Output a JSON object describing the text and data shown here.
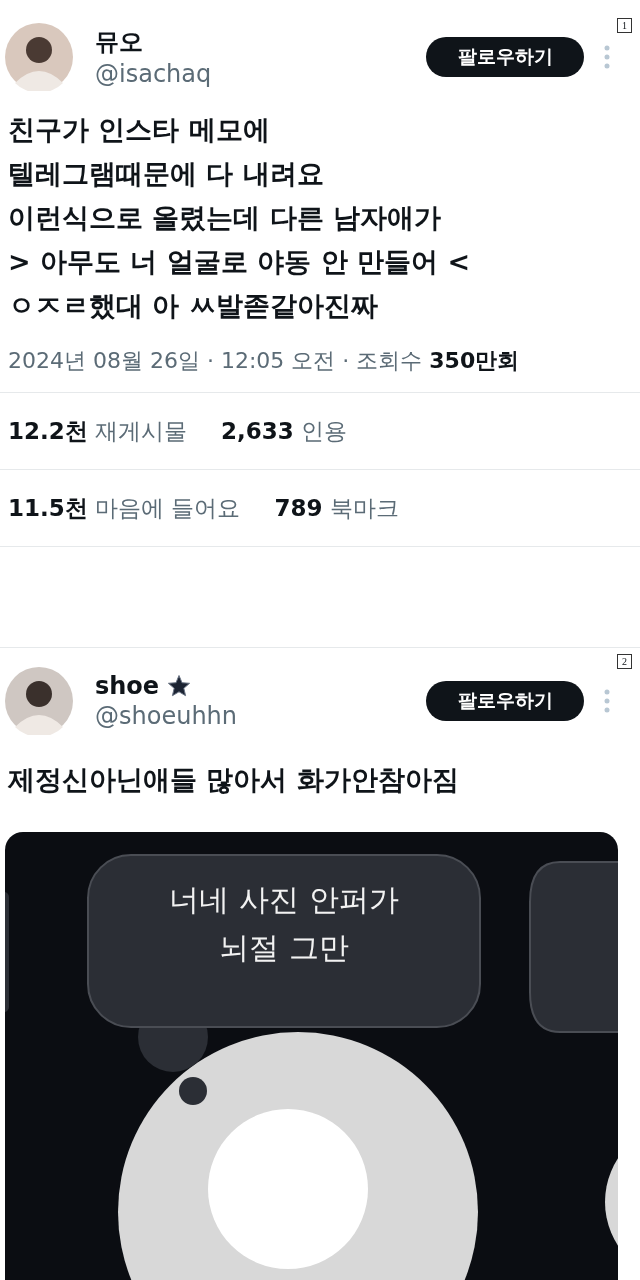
{
  "posts": [
    {
      "index": "1",
      "author": {
        "name": "뮤오",
        "handle": "@isachaq",
        "star": false
      },
      "follow_button": "팔로우하기",
      "text_lines": [
        "친구가 인스타 메모에",
        "텔레그램때문에 다 내려요",
        "이런식으로 올렸는데 다른 남자애가",
        "> 아무도 너 얼굴로 야동 안 만들어 <",
        "ㅇㅈㄹ했대 아 ㅆ발졷같아진짜"
      ],
      "meta": "2024년 08월 26일 · 12:05 오전 · 조회수 **350만회**",
      "stat_rows": [
        [
          "**12.2천** 재게시물",
          "**2,633** 인용"
        ],
        [
          "**11.5천** 마음에 들어요",
          "**789** 북마크"
        ]
      ]
    },
    {
      "index": "2",
      "author": {
        "name": "shoe",
        "handle": "@shoeuhhn",
        "star": true
      },
      "follow_button": "팔로우하기",
      "text_lines": [
        "제정신아닌애들 많아서 화가안참아짐"
      ],
      "media": {
        "kind": "notes-screenshot",
        "bubble_text": "너네 사진 안퍼가\n뇌절 그만"
      }
    }
  ]
}
